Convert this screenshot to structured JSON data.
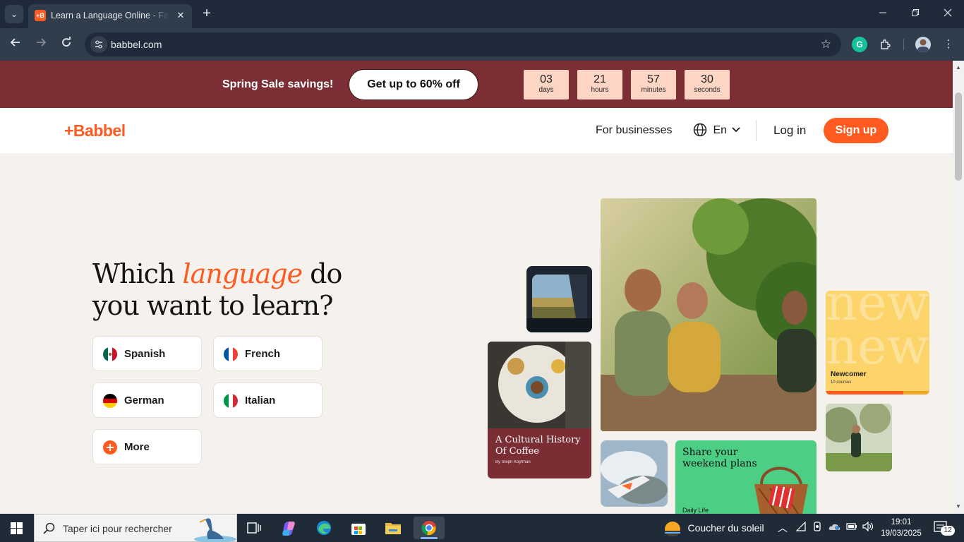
{
  "browser": {
    "tab_title": "Learn a Language Online - Fast and Effective",
    "tab_favicon": "+B",
    "url": "babbel.com",
    "new_tab": "+",
    "close": "✕"
  },
  "promo": {
    "text": "Spring Sale savings!",
    "cta": "Get up to 60% off",
    "countdown": [
      {
        "value": "03",
        "unit": "days"
      },
      {
        "value": "21",
        "unit": "hours"
      },
      {
        "value": "57",
        "unit": "minutes"
      },
      {
        "value": "30",
        "unit": "seconds"
      }
    ]
  },
  "header": {
    "logo": "+Babbel",
    "for_business": "For businesses",
    "lang": "En",
    "login": "Log in",
    "signup": "Sign up"
  },
  "hero": {
    "title_a": "Which ",
    "title_accent": "language",
    "title_b": " do you want to learn?",
    "languages": [
      {
        "label": "Spanish"
      },
      {
        "label": "French"
      },
      {
        "label": "German"
      },
      {
        "label": "Italian"
      },
      {
        "label": "More"
      }
    ]
  },
  "collage": {
    "coffee_title": "A Cultural History Of Coffee",
    "coffee_author": "By Steph Koyfman",
    "newcomer_title": "Newcomer",
    "newcomer_sub": "10 courses",
    "newcomer_bg": "new",
    "weekend_title": "Share your weekend plans",
    "weekend_tag": "Daily Life"
  },
  "taskbar": {
    "search_placeholder": "Taper ici pour rechercher",
    "weather": "Coucher du soleil",
    "time": "19:01",
    "date": "19/03/2025",
    "notifications": "12"
  },
  "colors": {
    "brand": "#ff5a1f",
    "promo_bg": "#7b2e33",
    "countdown_bg": "#fcd5c5",
    "page_bg": "#f5f2ed"
  }
}
